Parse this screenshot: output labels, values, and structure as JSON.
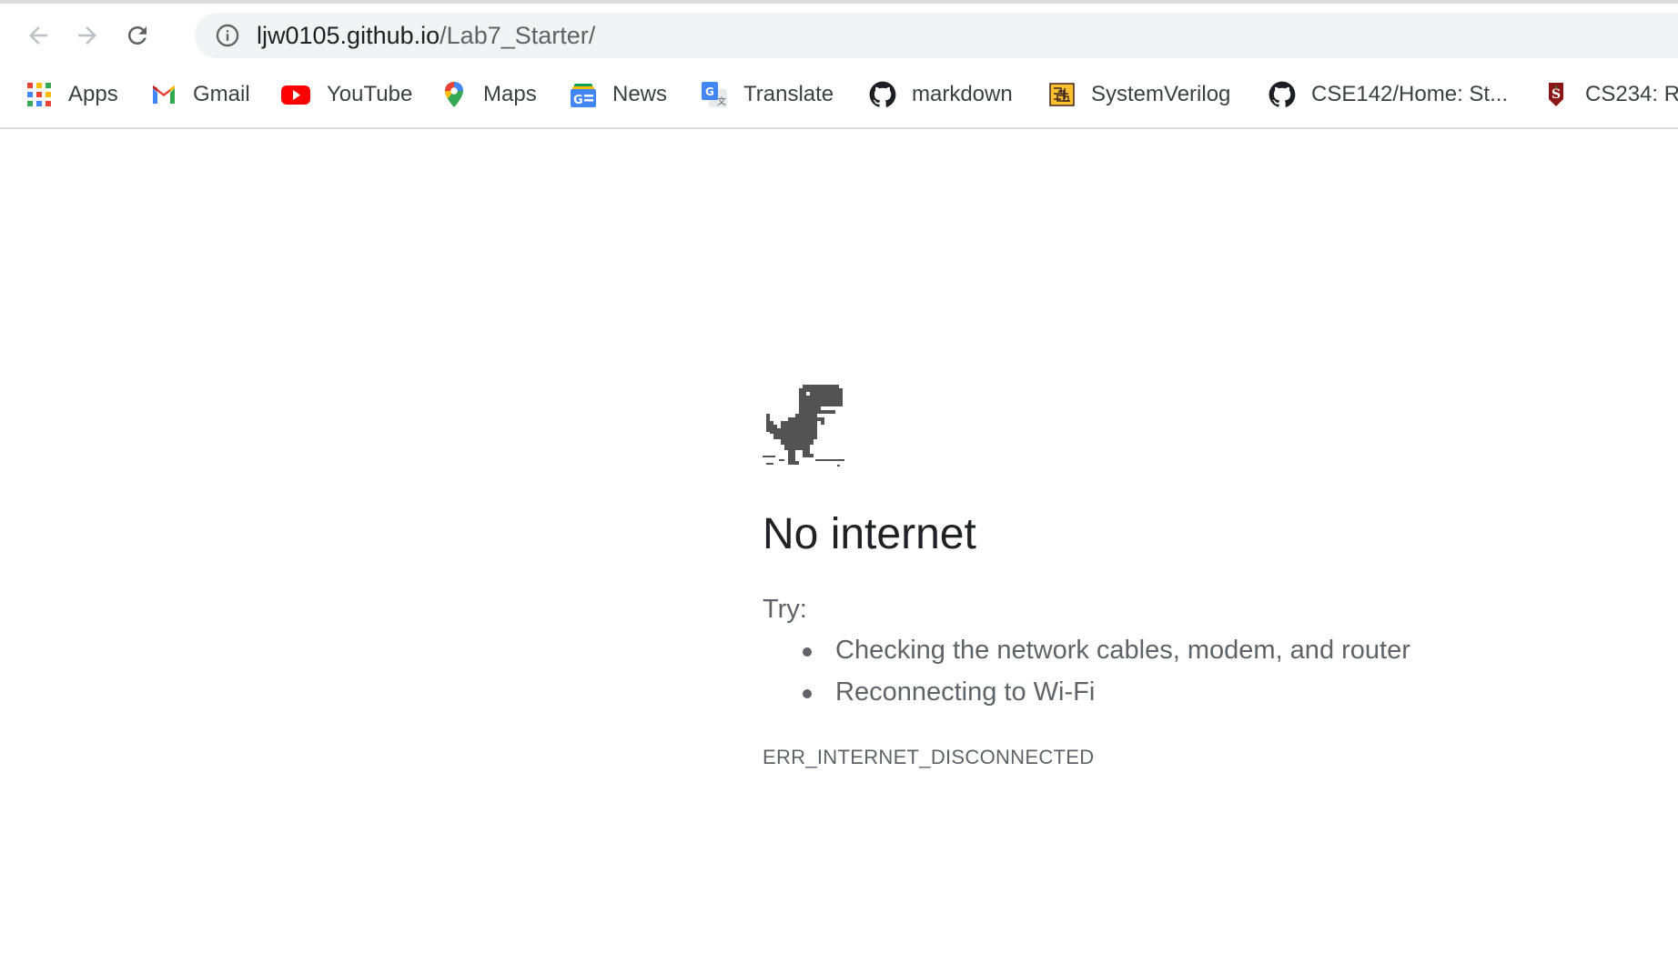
{
  "browser": {
    "url_host": "ljw0105.github.io",
    "url_path": "/Lab7_Starter/",
    "bookmarks": [
      {
        "label": "Apps",
        "icon": "apps-grid-icon"
      },
      {
        "label": "Gmail",
        "icon": "gmail-icon"
      },
      {
        "label": "YouTube",
        "icon": "youtube-icon"
      },
      {
        "label": "Maps",
        "icon": "maps-pin-icon"
      },
      {
        "label": "News",
        "icon": "google-news-icon"
      },
      {
        "label": "Translate",
        "icon": "google-translate-icon"
      },
      {
        "label": "markdown",
        "icon": "github-icon"
      },
      {
        "label": "SystemVerilog",
        "icon": "circuit-icon"
      },
      {
        "label": "CSE142/Home: St...",
        "icon": "github-icon"
      },
      {
        "label": "CS234: R",
        "icon": "stanford-icon"
      }
    ]
  },
  "error_page": {
    "title": "No internet",
    "try_label": "Try:",
    "suggestions": [
      "Checking the network cables, modem, and router",
      "Reconnecting to Wi-Fi"
    ],
    "error_code": "ERR_INTERNET_DISCONNECTED"
  }
}
